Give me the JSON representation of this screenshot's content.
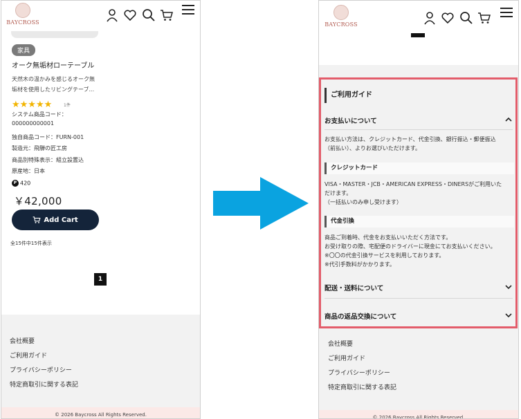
{
  "brand": {
    "name": "BAYCROSS"
  },
  "icons": {
    "user": "user-icon",
    "favorite": "heart-icon",
    "search": "search-icon",
    "cart": "cart-icon",
    "menu": "hamburger-menu-icon"
  },
  "left": {
    "product": {
      "tag": "家具",
      "name": "オーク無垢材ローテーブル",
      "desc_line1": "天然木の温かみを感じるオーク無",
      "desc_line2": "垢材を使用したリビングテーブ...",
      "rating_stars": "★★★★★",
      "rating_value": 5,
      "rating_count": "1件",
      "system_code_label": "システム商品コード：",
      "system_code_value": "000000000001",
      "own_code": "独自商品コード：FURN-001",
      "maker": "製造元：飛騨の匠工房",
      "special": "商品別特殊表示：組立設置込",
      "origin": "原産地：日本",
      "point_icon_label": "P",
      "points": "420",
      "price": "￥42,000",
      "cart_label": "Add Cart"
    },
    "count_text": "全15件中15件表示",
    "page_number": "1"
  },
  "footer": {
    "links": [
      "会社概要",
      "ご利用ガイド",
      "プライバシーポリシー",
      "特定商取引に関する表記"
    ],
    "copyright": "© 2026 Baycross All Rights Reserved."
  },
  "guide": {
    "title": "ご利用ガイド",
    "payment": {
      "heading": "お支払いについて",
      "intro_line1": "お支払い方法は、クレジットカード、代金引換、銀行振込・郵便振込",
      "intro_line2": "（前払い）、よりお選びいただけます。",
      "credit_heading": "クレジットカード",
      "credit_line1": "VISA・MASTER・JCB・AMERICAN EXPRESS・DINERSがご利用いた",
      "credit_line2": "だけます。",
      "credit_line3": "（一括払いのみ申し受けます）",
      "cod_heading": "代金引換",
      "cod_line1": "商品ご到着時、代金をお支払いいただく方法です。",
      "cod_line2": "お受け取りの際、宅配便のドライバーに現金にてお支払いください。",
      "cod_line3": "※〇〇の代金引換サービスを利用しております。",
      "cod_line4": "※代引手数料がかかります。"
    },
    "shipping_heading": "配送・送料について",
    "returns_heading": "商品の返品交換について"
  },
  "colors": {
    "highlight_border": "#e35c6a",
    "arrow": "#0aa3e0",
    "cart_button": "#14243a",
    "star": "#f2b400",
    "copyright_bg": "#fbe9e7"
  }
}
